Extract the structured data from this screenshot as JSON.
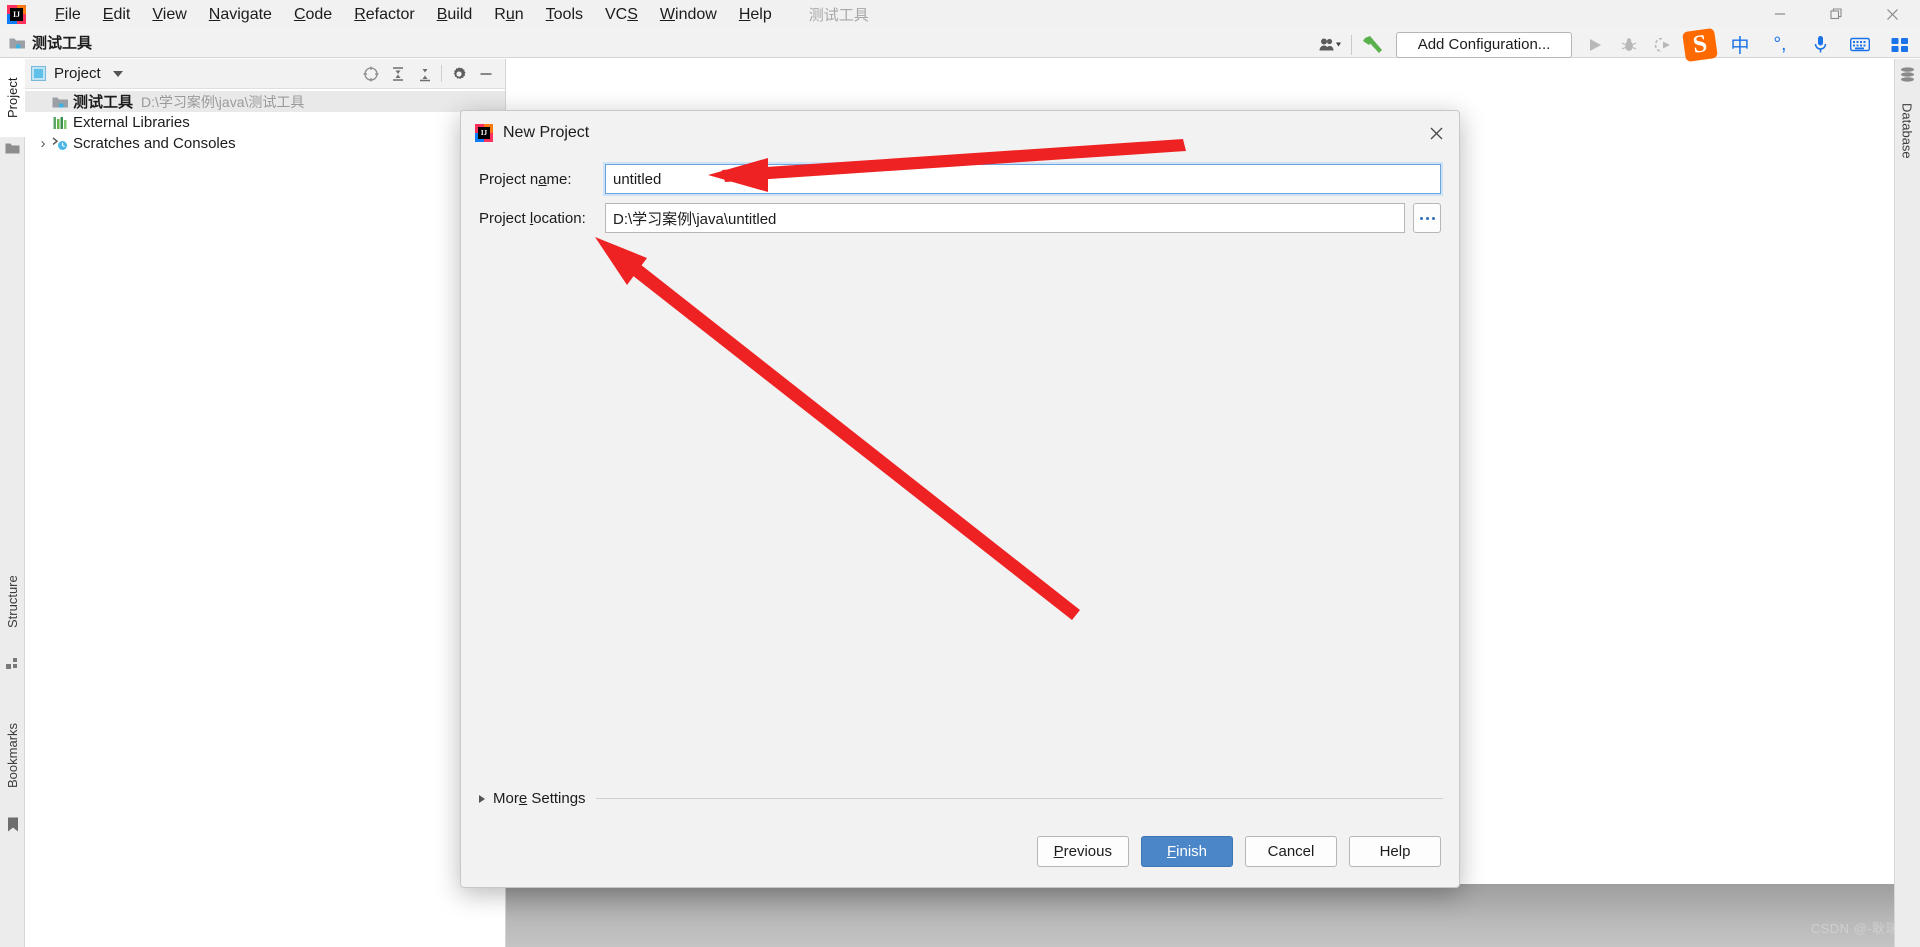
{
  "app": {
    "logo_letters": "IJ",
    "window_title": "测试工具"
  },
  "menubar": {
    "items": [
      {
        "label": "File",
        "mnemonic": "F"
      },
      {
        "label": "Edit",
        "mnemonic": "E"
      },
      {
        "label": "View",
        "mnemonic": "V"
      },
      {
        "label": "Navigate",
        "mnemonic": "N"
      },
      {
        "label": "Code",
        "mnemonic": "C"
      },
      {
        "label": "Refactor",
        "mnemonic": "R"
      },
      {
        "label": "Build",
        "mnemonic": "B"
      },
      {
        "label": "Run",
        "mnemonic": "u"
      },
      {
        "label": "Tools",
        "mnemonic": "T"
      },
      {
        "label": "VCS",
        "mnemonic": "S"
      },
      {
        "label": "Window",
        "mnemonic": "W"
      },
      {
        "label": "Help",
        "mnemonic": "H"
      }
    ]
  },
  "window_controls": {
    "minimize": "minimize-icon",
    "restore": "restore-icon",
    "close": "close-icon"
  },
  "navbar": {
    "breadcrumb": "测试工具",
    "folder_icon": "folder-icon"
  },
  "toolbar": {
    "user_icon": "user-accounts-icon",
    "build_icon": "build-hammer-icon",
    "add_configuration_label": "Add Configuration...",
    "run_icon": "run-icon",
    "debug_icon": "debug-icon",
    "coverage_icon": "run-with-coverage-icon"
  },
  "ime": {
    "brand": "S",
    "mode_label": "中",
    "punctuation_label": "°,",
    "mic_icon": "microphone-icon",
    "keyboard_icon": "keyboard-icon",
    "apps_icon": "toolbox-icon"
  },
  "left_tool_strip": {
    "tabs": [
      {
        "label": "Project",
        "icon": "project-icon",
        "active": true
      },
      {
        "label": "Structure",
        "icon": "structure-icon",
        "active": false
      },
      {
        "label": "Bookmarks",
        "icon": "bookmark-icon",
        "active": false
      }
    ]
  },
  "right_tool_strip": {
    "tabs": [
      {
        "label": "Database",
        "icon": "database-icon"
      }
    ]
  },
  "project_panel": {
    "title": "Project",
    "view_icon": "project-view-icon",
    "dropdown_icon": "chevron-down-icon",
    "actions": [
      {
        "name": "select-opened-file-icon",
        "label": "Select Opened File"
      },
      {
        "name": "expand-all-icon",
        "label": "Expand All"
      },
      {
        "name": "collapse-all-icon",
        "label": "Collapse All"
      },
      {
        "name": "settings-gear-icon",
        "label": "Settings"
      },
      {
        "name": "hide-icon",
        "label": "Hide"
      }
    ],
    "tree": [
      {
        "label": "测试工具",
        "secondary": "D:\\学习案例\\java\\测试工具",
        "icon": "project-folder-icon",
        "selected": true,
        "bold": true,
        "twisty": ""
      },
      {
        "label": "External Libraries",
        "secondary": "",
        "icon": "libraries-icon",
        "selected": false,
        "bold": false,
        "twisty": ""
      },
      {
        "label": "Scratches and Consoles",
        "secondary": "",
        "icon": "scratches-icon",
        "selected": false,
        "bold": false,
        "twisty": "›"
      }
    ]
  },
  "dialog": {
    "title": "New Project",
    "close_icon": "close-icon",
    "fields": [
      {
        "label": "Project name:",
        "mnemonic": "a",
        "value": "untitled",
        "focused": true,
        "has_browse": false
      },
      {
        "label": "Project location:",
        "mnemonic": "l",
        "value": "D:\\学习案例\\java\\untitled",
        "focused": false,
        "has_browse": true,
        "browse_label": "..."
      }
    ],
    "more_settings_label": "More Settings",
    "more_settings_mnemonic": "e",
    "buttons": [
      {
        "label": "Previous",
        "mnemonic": "P",
        "primary": false
      },
      {
        "label": "Finish",
        "mnemonic": "F",
        "primary": true
      },
      {
        "label": "Cancel",
        "mnemonic": "",
        "primary": false
      },
      {
        "label": "Help",
        "mnemonic": "",
        "primary": false
      }
    ]
  },
  "annotations": {
    "arrow_color": "#ee2222",
    "watermark": "CSDN @-耿瑞-"
  },
  "colors": {
    "accent_blue": "#4a86c8",
    "panel_bg": "#f2f2f2",
    "selection": "#e9e9e9",
    "ime_blue": "#1a73e8",
    "sogou_orange": "#ff6a00"
  }
}
